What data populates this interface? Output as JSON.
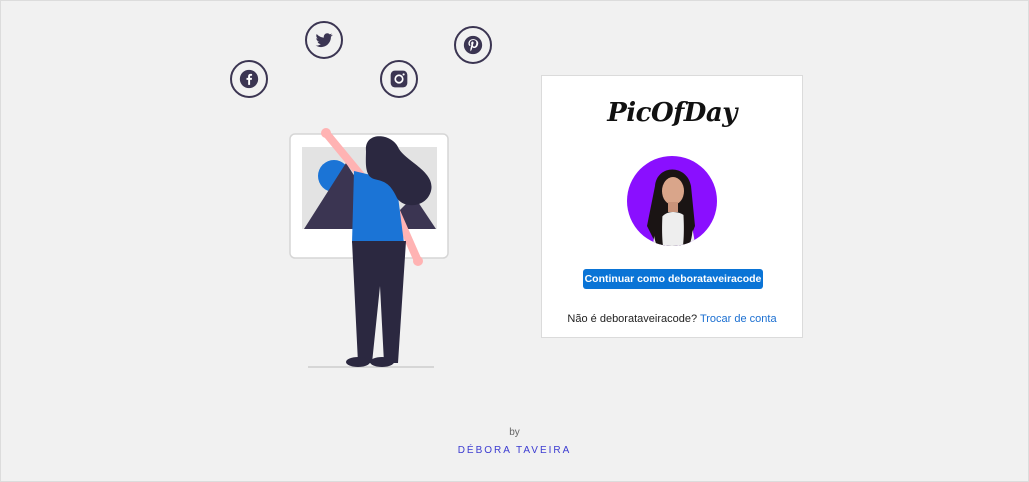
{
  "social": [
    {
      "name": "facebook",
      "icon": "facebook-icon"
    },
    {
      "name": "twitter",
      "icon": "twitter-icon"
    },
    {
      "name": "instagram",
      "icon": "instagram-icon"
    },
    {
      "name": "pinterest",
      "icon": "pinterest-icon"
    }
  ],
  "card": {
    "logo": "PicOfDay",
    "avatar_icon": "profile-photo",
    "continue_label": "Continuar como deborataveiracode",
    "not_you": "Não é deborataveiracode?",
    "switch_label": "Trocar de conta"
  },
  "footer": {
    "by": "by",
    "author": "DÉBORA TAVEIRA"
  },
  "colors": {
    "background": "#f1f1f1",
    "primary_button": "#0a74d6",
    "link": "#1b6fd1",
    "avatar_bg": "#8a0fff",
    "author": "#3b3bd1",
    "icon_stroke": "#3b3552"
  }
}
